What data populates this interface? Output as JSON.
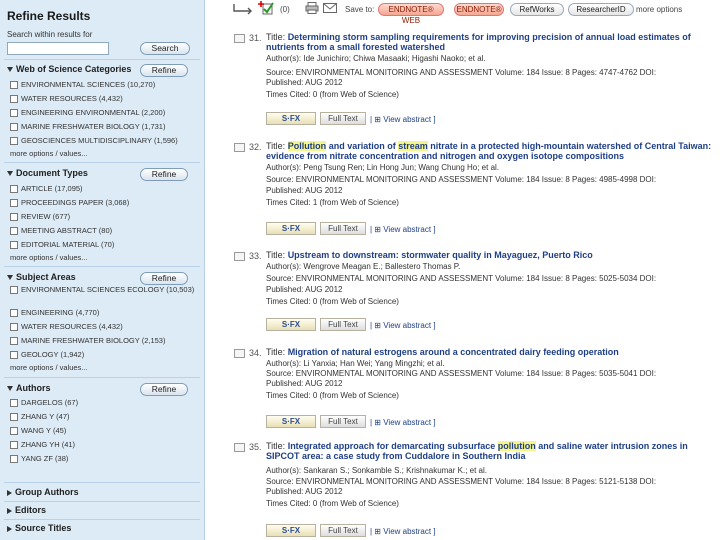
{
  "sidebar": {
    "title": "Refine Results",
    "search_label": "Search within results for",
    "search_value": "",
    "search_button": "Search",
    "refine_label": "Refine",
    "more_label": "more options / values...",
    "sections": [
      {
        "title": "Web of Science Categories",
        "expanded": true,
        "items": [
          "ENVIRONMENTAL SCIENCES (10,270)",
          "WATER RESOURCES (4,432)",
          "ENGINEERING ENVIRONMENTAL (2,200)",
          "MARINE FRESHWATER BIOLOGY (1,731)",
          "GEOSCIENCES MULTIDISCIPLINARY (1,596)"
        ]
      },
      {
        "title": "Document Types",
        "expanded": true,
        "items": [
          "ARTICLE (17,095)",
          "PROCEEDINGS PAPER (3,068)",
          "REVIEW (677)",
          "MEETING ABSTRACT (80)",
          "EDITORIAL MATERIAL (70)"
        ]
      },
      {
        "title": "Subject Areas",
        "expanded": true,
        "items": [
          "ENVIRONMENTAL SCIENCES ECOLOGY (10,503)",
          "ENGINEERING (4,770)",
          "WATER RESOURCES (4,432)",
          "MARINE FRESHWATER BIOLOGY (2,153)",
          "GEOLOGY (1,942)"
        ]
      },
      {
        "title": "Authors",
        "expanded": true,
        "items": [
          "DARGELOS (67)",
          "ZHANG Y (47)",
          "WANG Y (45)",
          "ZHANG YH (41)",
          "YANG ZF (38)"
        ]
      },
      {
        "title": "Group Authors",
        "expanded": false,
        "items": []
      },
      {
        "title": "Editors",
        "expanded": false,
        "items": []
      },
      {
        "title": "Source Titles",
        "expanded": false,
        "items": []
      }
    ]
  },
  "toolbar": {
    "count": "(0)",
    "save_to": "Save to:",
    "buttons": [
      "ENDNOTE® WEB",
      "ENDNOTE®",
      "RefWorks",
      "ResearcherID"
    ],
    "more": "more options"
  },
  "records": [
    {
      "num": "31.",
      "title_label": "Title:",
      "title": [
        {
          "t": "Determining storm sampling requirements for improving precision of annual load estimates of nutrients from a small forested watershed",
          "hl": false
        }
      ],
      "authors": "Author(s): Ide Junichiro; Chiwa Masaaki; Higashi Naoko; et al.",
      "source": "Source: ENVIRONMENTAL MONITORING AND ASSESSMENT   Volume: 184   Issue: 8   Pages: 4747-4762   DOI:",
      "published": "Published: AUG 2012",
      "cited": "Times Cited: 0 (from Web of Science)",
      "sfx": "S·FX",
      "fulltext": "Full Text",
      "view": "| ⊞ View abstract ]"
    },
    {
      "num": "32.",
      "title_label": "Title:",
      "title": [
        {
          "t": "Pollution",
          "hl": true
        },
        {
          "t": " and variation of ",
          "hl": false
        },
        {
          "t": "stream",
          "hl": true
        },
        {
          "t": " nitrate in a protected high-mountain watershed of Central Taiwan: evidence from nitrate concentration and nitrogen and oxygen isotope compositions",
          "hl": false
        }
      ],
      "authors": "Author(s): Peng Tsung Ren; Lin Hong Jun; Wang Chung Ho; et al.",
      "source": "Source: ENVIRONMENTAL MONITORING AND ASSESSMENT   Volume: 184   Issue: 8   Pages: 4985-4998   DOI:",
      "published": "Published: AUG 2012",
      "cited": "Times Cited: 1 (from Web of Science)",
      "sfx": "S·FX",
      "fulltext": "Full Text",
      "view": "| ⊞ View abstract ]"
    },
    {
      "num": "33.",
      "title_label": "Title:",
      "title": [
        {
          "t": "Upstream to downstream: stormwater quality in Mayaguez, Puerto Rico",
          "hl": false
        }
      ],
      "authors": "Author(s): Wengrove Meagan E.; Ballestero Thomas P.",
      "source": "Source: ENVIRONMENTAL MONITORING AND ASSESSMENT   Volume: 184   Issue: 8   Pages: 5025-5034   DOI:",
      "published": "Published: AUG 2012",
      "cited": "Times Cited: 0 (from Web of Science)",
      "sfx": "S·FX",
      "fulltext": "Full Text",
      "view": "| ⊞ View abstract ]"
    },
    {
      "num": "34.",
      "title_label": "Title:",
      "title": [
        {
          "t": "Migration of natural estrogens",
          "hl": false
        },
        {
          "t": " around a concentrated dairy feeding operation",
          "hl": false
        }
      ],
      "authors": "Author(s): Li Yanxia; Han Wei; Yang Mingzhi; et al.",
      "source": "Source: ENVIRONMENTAL MONITORING AND ASSESSMENT   Volume: 184   Issue: 8   Pages: 5035-5041   DOI:",
      "published": "Published: AUG 2012",
      "cited": "Times Cited: 0 (from Web of Science)",
      "sfx": "S·FX",
      "fulltext": "Full Text",
      "view": "| ⊞ View abstract ]"
    },
    {
      "num": "35.",
      "title_label": "Title:",
      "title": [
        {
          "t": "Integrated approach for demarcating subsurface ",
          "hl": false
        },
        {
          "t": "pollution",
          "hl": true
        },
        {
          "t": " and saline water intrusion zones in SIPCOT area: a case study from Cuddalore in Southern India",
          "hl": false
        }
      ],
      "authors": "Author(s): Sankaran S.; Sonkamble S.; Krishnakumar K.; et al.",
      "source": "Source: ENVIRONMENTAL MONITORING AND ASSESSMENT   Volume: 184   Issue: 8   Pages: 5121-5138   DOI:",
      "published": "Published: AUG 2012",
      "cited": "Times Cited: 0 (from Web of Science)",
      "sfx": "S·FX",
      "fulltext": "Full Text",
      "view": "| ⊞ View abstract ]"
    }
  ]
}
